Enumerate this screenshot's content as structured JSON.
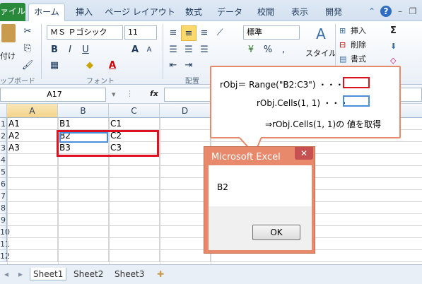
{
  "tabs": [
    "ァイル",
    "ホーム",
    "挿入",
    "ページ レイアウト",
    "数式",
    "データ",
    "校閲",
    "表示",
    "開発"
  ],
  "ribbon": {
    "paste_label": "付け",
    "clipboard_group": "ップボード",
    "font_name": "ＭＳ Ｐゴシック",
    "font_size": "11",
    "font_group": "フォント",
    "align_group": "配置",
    "number_format": "標準",
    "percent": "%",
    "comma": ",",
    "style_label": "スタイル",
    "insert_label": "挿入",
    "delete_label": "削除",
    "format_label": "書式",
    "sigma": "Σ",
    "bold": "B",
    "italic": "I",
    "underline": "U",
    "font_grow": "A",
    "font_shrink": "A",
    "font_color": "A"
  },
  "formula_bar": {
    "name_box": "A17",
    "fx": "fx"
  },
  "columns": [
    "A",
    "B",
    "C",
    "D"
  ],
  "rows": [
    {
      "num": "1",
      "cells": [
        "A1",
        "B1",
        "C1",
        ""
      ]
    },
    {
      "num": "2",
      "cells": [
        "A2",
        "B2",
        "C2",
        ""
      ]
    },
    {
      "num": "3",
      "cells": [
        "A3",
        "B3",
        "C3",
        ""
      ]
    },
    {
      "num": "4",
      "cells": [
        "",
        "",
        "",
        ""
      ]
    },
    {
      "num": "5",
      "cells": [
        "",
        "",
        "",
        ""
      ]
    },
    {
      "num": "6",
      "cells": [
        "",
        "",
        "",
        ""
      ]
    },
    {
      "num": "7",
      "cells": [
        "",
        "",
        "",
        ""
      ]
    },
    {
      "num": "8",
      "cells": [
        "",
        "",
        "",
        ""
      ]
    },
    {
      "num": "9",
      "cells": [
        "",
        "",
        "",
        ""
      ]
    },
    {
      "num": "10",
      "cells": [
        "",
        "",
        "",
        ""
      ]
    },
    {
      "num": "11",
      "cells": [
        "",
        "",
        "",
        ""
      ]
    },
    {
      "num": "12",
      "cells": [
        "",
        "",
        "",
        ""
      ]
    }
  ],
  "sheets": [
    "Sheet1",
    "Sheet2",
    "Sheet3"
  ],
  "callout": {
    "line1_label": "rObj＝ Range(\"B2:C3\") ・・・",
    "line2_label": "rObj.Cells(1, 1) ・・・",
    "line3": "⇒rObj.Cells(1, 1)の 値を取得",
    "red_color": "#dd1122",
    "blue_color": "#4a8fd9"
  },
  "dialog": {
    "title": "Microsoft Excel",
    "message": "B2",
    "ok_label": "OK",
    "close_label": "✕"
  }
}
